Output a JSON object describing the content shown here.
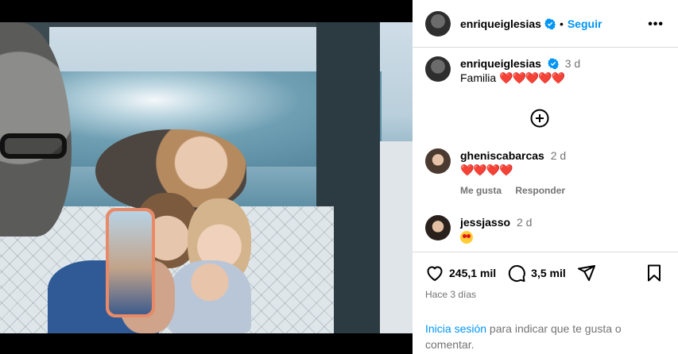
{
  "post": {
    "author": "enriqueiglesias",
    "follow_label": "Seguir",
    "separator": "•",
    "more_label": "•••"
  },
  "caption": {
    "author": "enriqueiglesias",
    "time": "3 d",
    "text": "Familia",
    "hearts": "❤️❤️❤️❤️❤️"
  },
  "comments": [
    {
      "author": "gheniscabarcas",
      "time": "2 d",
      "text": "❤️❤️❤️❤️",
      "like_label": "Me gusta",
      "reply_label": "Responder"
    },
    {
      "author": "jessjasso",
      "time": "2 d"
    }
  ],
  "stats": {
    "likes": "245,1 mil",
    "comments": "3,5 mil",
    "ago": "Hace 3 días"
  },
  "login": {
    "link": "Inicia sesión",
    "rest": " para indicar que te gusta o comentar."
  },
  "colors": {
    "accent": "#0095f6",
    "muted": "#737373",
    "border": "#dbdbdb",
    "heart": "#e0131d"
  },
  "icons": [
    "verified-icon",
    "more-icon",
    "add-comment-icon",
    "heart-icon",
    "comment-icon",
    "share-icon",
    "bookmark-icon"
  ]
}
